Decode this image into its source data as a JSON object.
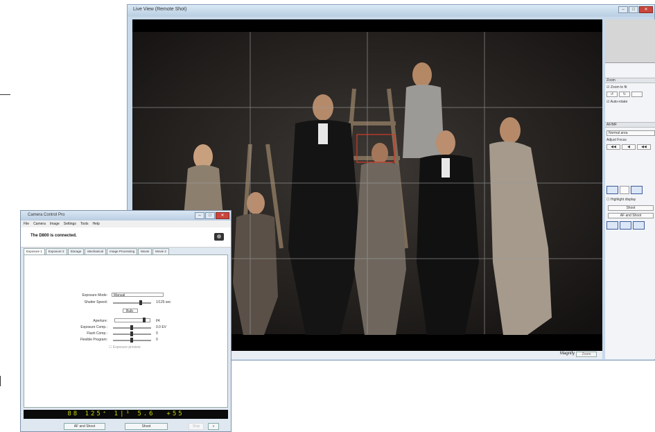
{
  "live_view": {
    "title": "Live View (Remote Shot)",
    "zoom_label": "Magnify",
    "zoom_button": "Zoom",
    "panel": {
      "sections": [
        {
          "title": "Zoom"
        },
        {
          "title": "AF/MF"
        }
      ],
      "zoom_fit_label": "Zoom to fit",
      "rotate_buttons": [
        "↺",
        "↻"
      ],
      "auto_rotate_label": "Auto-rotate",
      "af_mode_label": "Normal area",
      "adjust_focus_label": "Adjust Focus",
      "focus_buttons": [
        "◀◀",
        "◀",
        "◀◀"
      ],
      "highlight_label": "Highlight display",
      "shoot_button": "Shoot",
      "af_shoot_button": "AF and Shoot"
    }
  },
  "remote": {
    "title": "Camera Control Pro",
    "menu": [
      "File",
      "Camera",
      "Image",
      "Settings",
      "Tools",
      "Help"
    ],
    "connection_text": "The D800 is connected.",
    "tabs": [
      "Exposure 1",
      "Exposure 2",
      "Storage",
      "Mechanical",
      "Image Processing",
      "Movie",
      "Movie 2"
    ],
    "settings": [
      {
        "label": "Exposure Mode:",
        "value": "Manual"
      },
      {
        "label": "Shutter Speed:",
        "value": "1/125 sec"
      },
      {
        "label": "Aperture:",
        "value": "f/4"
      },
      {
        "label": "Exposure Comp.:",
        "value": "0.0 EV"
      },
      {
        "label": "Flash Comp.:",
        "value": "0"
      },
      {
        "label": "Flexible Program:",
        "value": "0"
      }
    ],
    "bulb_button": "Bulb",
    "exposure_check_label": "Exposure preview",
    "readout": "88  125⁺ 1|¹ 5.6   +55",
    "footer_buttons": {
      "af_shoot": "AF and Shoot",
      "shoot": "Shoot",
      "stop": "Stop",
      "more": "»"
    }
  }
}
